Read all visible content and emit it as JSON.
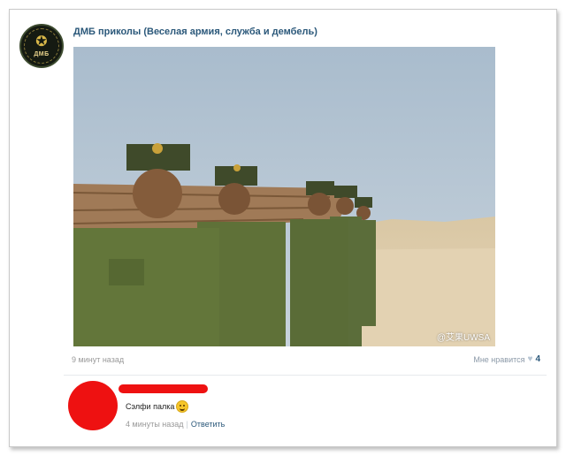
{
  "post": {
    "group_name": "ДМБ приколы (Веселая армия, служба и дембель)",
    "avatar_badge": "ДМБ",
    "photo_watermark": "@艾果UWSA",
    "timestamp": "9 минут назад",
    "like_label": "Мне нравится",
    "like_count": "4"
  },
  "comment": {
    "text": "Сэлфи палка",
    "emoji": "smile-emoji",
    "time": "4 минуты назад",
    "separator": "|",
    "reply_label": "Ответить"
  },
  "colors": {
    "link": "#2b587a",
    "muted": "#999999",
    "redaction": "#ee1111"
  }
}
